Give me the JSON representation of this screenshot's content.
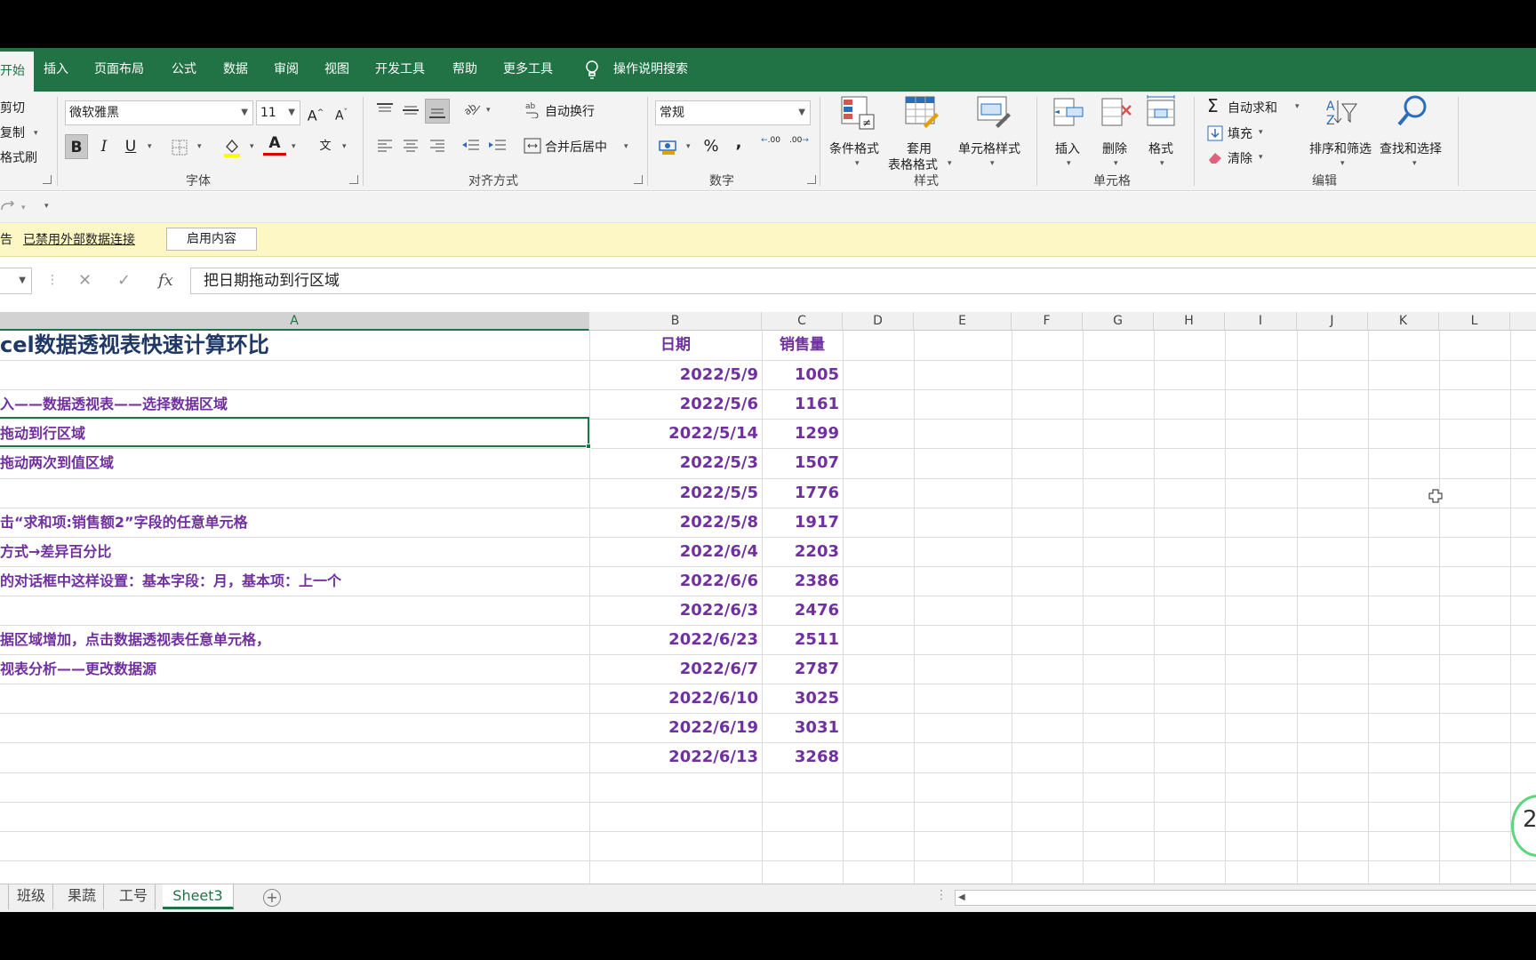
{
  "menu": {
    "tabs": [
      "开始",
      "插入",
      "页面布局",
      "公式",
      "数据",
      "审阅",
      "视图",
      "开发工具",
      "帮助",
      "更多工具"
    ],
    "search": "操作说明搜索"
  },
  "ribbon": {
    "clipboard": {
      "cut": "剪切",
      "copy": "复制",
      "painter": "格式刷"
    },
    "font": {
      "name": "微软雅黑",
      "size": "11",
      "grow": "A",
      "shrink": "A",
      "bold": "B",
      "italic": "I",
      "underline": "U",
      "font_color": "A",
      "phonetic": "文",
      "group": "字体"
    },
    "alignment": {
      "wrap": "自动换行",
      "merge": "合并后居中",
      "group": "对齐方式"
    },
    "number": {
      "format": "常规",
      "percent": "%",
      "comma": ",",
      "inc_dec": ".00",
      "dec_dec": ".00",
      "group": "数字"
    },
    "styles": {
      "conditional": "条件格式",
      "table_1": "套用",
      "table_2": "表格格式",
      "cell_styles": "单元格样式",
      "group": "样式"
    },
    "cells": {
      "insert": "插入",
      "delete": "删除",
      "format": "格式",
      "group": "单元格"
    },
    "editing": {
      "autosum": "自动求和",
      "fill": "填充",
      "clear": "清除",
      "sort": "排序和筛选",
      "find": "查找和选择",
      "group": "编辑"
    }
  },
  "security": {
    "label": "告",
    "link": "已禁用外部数据连接",
    "button": "启用内容"
  },
  "formula": {
    "fx": "fx",
    "content": "把日期拖动到行区域"
  },
  "columns": [
    "A",
    "B",
    "C",
    "D",
    "E",
    "F",
    "G",
    "H",
    "I",
    "J",
    "K",
    "L"
  ],
  "sheet": {
    "title": "cel数据透视表快速计算环比",
    "header_date": "日期",
    "header_sales": "销售量",
    "notes": [
      "",
      "入——数据透视表——选择数据区域",
      "拖动到行区域",
      "拖动两次到值区域",
      "",
      "击“求和项:销售额2”字段的任意单元格",
      "方式→差异百分比",
      "的对话框中这样设置：基本字段：月，基本项：上一个",
      "",
      "据区域增加，点击数据透视表任意单元格，",
      "视表分析——更改数据源",
      "",
      "",
      ""
    ],
    "dates": [
      "2022/5/9",
      "2022/5/6",
      "2022/5/14",
      "2022/5/3",
      "2022/5/5",
      "2022/5/8",
      "2022/6/4",
      "2022/6/6",
      "2022/6/3",
      "2022/6/23",
      "2022/6/7",
      "2022/6/10",
      "2022/6/19",
      "2022/6/13"
    ],
    "sales": [
      "1005",
      "1161",
      "1299",
      "1507",
      "1776",
      "1917",
      "2203",
      "2386",
      "2476",
      "2511",
      "2787",
      "3025",
      "3031",
      "3268"
    ]
  },
  "sheet_tabs": [
    "班级",
    "果蔬",
    "工号",
    "Sheet3"
  ],
  "active_sheet": "Sheet3",
  "badge": "2",
  "colors": {
    "excel_green": "#217346",
    "data_purple": "#7030a0",
    "title_navy": "#1f3864",
    "security_bar": "#fdf7c6"
  }
}
